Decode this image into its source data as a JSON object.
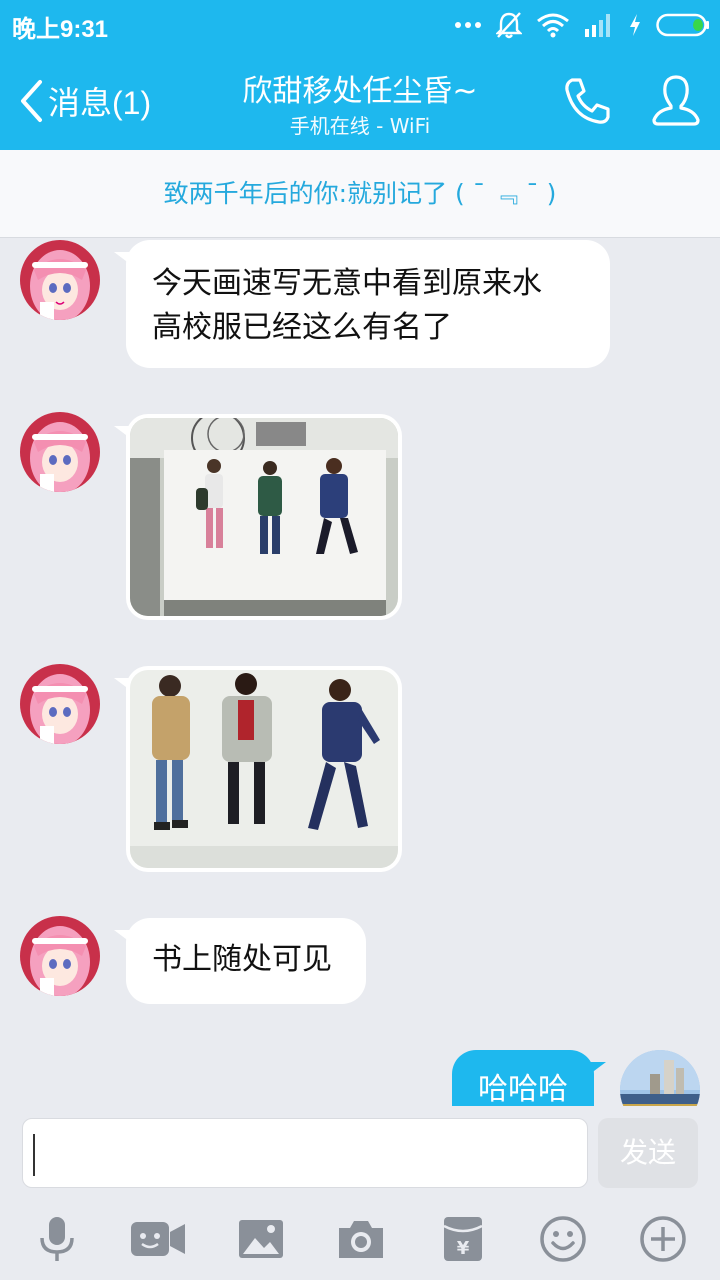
{
  "status_bar": {
    "time": "晚上9:31",
    "icons": [
      "more-dots-icon",
      "alarm-off-icon",
      "wifi-icon",
      "signal-icon",
      "charging-icon",
      "battery-icon"
    ]
  },
  "header": {
    "back_label": "消息(1)",
    "title": "欣甜移处任尘昏~",
    "subtitle": "手机在线 - WiFi",
    "call_icon": "phone-icon",
    "profile_icon": "person-icon"
  },
  "banner": {
    "text": "致两千年后的你:就别记了 ( ˉ ﹃ ˉ )"
  },
  "messages": [
    {
      "from": "friend",
      "type": "text",
      "lines": [
        "今天画速写无意中看到原来水",
        "高校服已经这么有名了"
      ]
    },
    {
      "from": "friend",
      "type": "image",
      "icon": "photo-sketchbook-three-girls"
    },
    {
      "from": "friend",
      "type": "image",
      "icon": "photo-three-girls-jackets"
    },
    {
      "from": "friend",
      "type": "text",
      "lines": [
        "书上随处可见"
      ]
    },
    {
      "from": "me",
      "type": "text",
      "lines": [
        "哈哈哈"
      ]
    }
  ],
  "input": {
    "value": "",
    "send_label": "发送"
  },
  "toolbar": {
    "icons": [
      "microphone-icon",
      "video-call-icon",
      "image-icon",
      "camera-icon",
      "red-packet-icon",
      "emoji-icon",
      "plus-icon"
    ]
  },
  "colors": {
    "accent": "#1eb8ee",
    "banner_text": "#25a9dd",
    "background": "#e9ebf0"
  }
}
